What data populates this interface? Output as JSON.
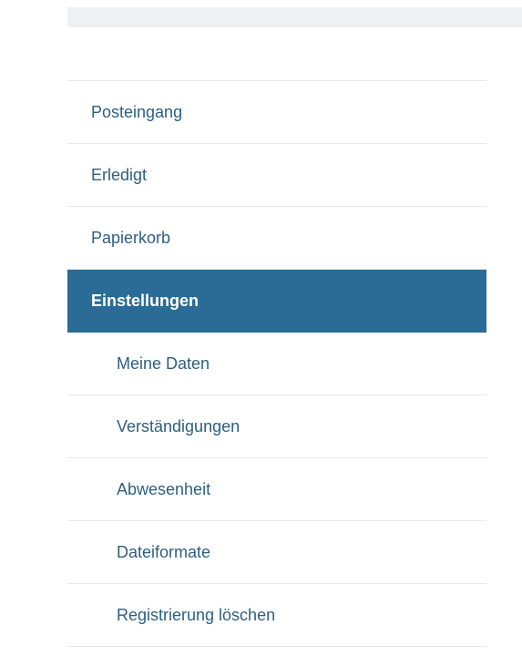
{
  "nav": {
    "items": [
      {
        "label": "Posteingang"
      },
      {
        "label": "Erledigt"
      },
      {
        "label": "Papierkorb"
      },
      {
        "label": "Einstellungen"
      }
    ],
    "subitems": [
      {
        "label": "Meine Daten"
      },
      {
        "label": "Verständigungen"
      },
      {
        "label": "Abwesenheit"
      },
      {
        "label": "Dateiformate"
      },
      {
        "label": "Registrierung löschen"
      }
    ]
  },
  "colors": {
    "active_background": "#2a6c96",
    "link_text": "#2d5f82",
    "divider": "#e6e9ec",
    "top_strip": "#eef1f4"
  }
}
